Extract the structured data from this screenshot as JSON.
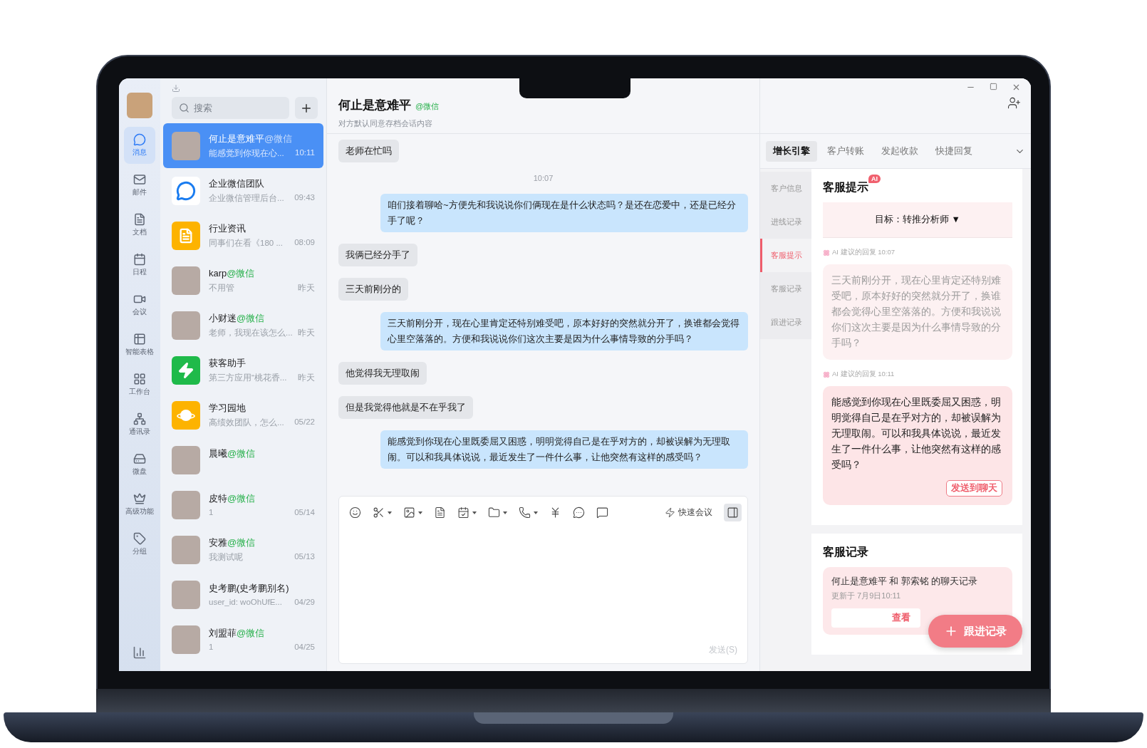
{
  "nav": {
    "items": [
      {
        "label": "消息",
        "selected": true
      },
      {
        "label": "邮件",
        "selected": false
      },
      {
        "label": "文档",
        "selected": false
      },
      {
        "label": "日程",
        "selected": false
      },
      {
        "label": "会议",
        "selected": false
      },
      {
        "label": "智能表格",
        "selected": false
      },
      {
        "label": "工作台",
        "selected": false
      },
      {
        "label": "通讯录",
        "selected": false
      },
      {
        "label": "微盘",
        "selected": false
      },
      {
        "label": "高级功能",
        "selected": false
      },
      {
        "label": "分组",
        "selected": false
      }
    ]
  },
  "chat_list": {
    "search": {
      "placeholder": "搜索"
    },
    "chats": [
      {
        "name": "何止是意难平",
        "tag": "@微信",
        "preview": "能感觉到你现在心...",
        "time": "10:11",
        "selected": true,
        "kind": "photo"
      },
      {
        "name": "企业微信团队",
        "preview": "企业微信管理后台...",
        "time": "09:43",
        "selected": false,
        "kind": "chat",
        "color": "#ffffff"
      },
      {
        "name": "行业资讯",
        "preview": "同事们在看《180 ...",
        "time": "08:09",
        "selected": false,
        "kind": "note",
        "color": "#fdb300"
      },
      {
        "name": "karp",
        "tag": "@微信",
        "preview": "不用管",
        "time": "昨天",
        "selected": false,
        "kind": "photo"
      },
      {
        "name": "小财迷",
        "tag": "@微信",
        "preview": "老师，我现在该怎么...",
        "time": "昨天",
        "selected": false,
        "kind": "photo"
      },
      {
        "name": "获客助手",
        "preview": "第三方应用“桃花香...",
        "time": "昨天",
        "selected": false,
        "kind": "bolt",
        "color": "#1fba4a"
      },
      {
        "name": "学习园地",
        "preview": "高绩效团队，怎么...",
        "time": "05/22",
        "selected": false,
        "kind": "planet",
        "color": "#fdb300"
      },
      {
        "name": "晨曦",
        "tag": "@微信",
        "selected": false,
        "kind": "photo"
      },
      {
        "name": "皮特",
        "tag": "@微信",
        "preview": "1",
        "time": "05/14",
        "selected": false,
        "kind": "photo"
      },
      {
        "name": "安雅",
        "tag": "@微信",
        "preview": "我测试呢",
        "time": "05/13",
        "selected": false,
        "kind": "photo"
      },
      {
        "name": "史考鹏(史考鹏别名)",
        "preview": "user_id: woOhUfE...",
        "time": "04/29",
        "selected": false,
        "kind": "photo"
      },
      {
        "name": "刘盟菲",
        "tag": "@微信",
        "preview": "1",
        "time": "04/25",
        "selected": false,
        "kind": "photo"
      }
    ]
  },
  "chat": {
    "title": "何止是意难平",
    "tag": "@微信",
    "subtitle": "对方默认同意存档会话内容",
    "messages": [
      {
        "kind": "received",
        "text": "老师在忙吗"
      },
      {
        "kind": "time",
        "text": "10:07"
      },
      {
        "kind": "sent",
        "text": "咱们接着聊哈~方便先和我说说你们俩现在是什么状态吗？是还在恋爱中，还是已经分手了呢？"
      },
      {
        "kind": "received",
        "text": "我俩已经分手了"
      },
      {
        "kind": "received",
        "text": "三天前刚分的"
      },
      {
        "kind": "sent",
        "text": "三天前刚分开，现在心里肯定还特别难受吧，原本好好的突然就分开了，换谁都会觉得心里空落落的。方便和我说说你们这次主要是因为什么事情导致的分手吗？"
      },
      {
        "kind": "received",
        "text": "他觉得我无理取闹"
      },
      {
        "kind": "received",
        "text": "但是我觉得他就是不在乎我了"
      },
      {
        "kind": "sent",
        "text": "能感觉到你现在心里既委屈又困惑，明明觉得自己是在乎对方的，却被误解为无理取闹。可以和我具体说说，最近发生了一件什么事，让他突然有这样的感受吗？"
      }
    ],
    "quick_meeting": "快速会议",
    "send": "发送(S)"
  },
  "assistant": {
    "tabs": [
      {
        "label": "增长引擎",
        "selected": true
      },
      {
        "label": "客户转账",
        "selected": false
      },
      {
        "label": "发起收款",
        "selected": false
      },
      {
        "label": "快捷回复",
        "selected": false
      }
    ],
    "sections": [
      {
        "label": "客户信息",
        "selected": false
      },
      {
        "label": "进线记录",
        "selected": false
      },
      {
        "label": "客服提示",
        "selected": true
      },
      {
        "label": "客服记录",
        "selected": false
      },
      {
        "label": "跟进记录",
        "selected": false
      }
    ],
    "hint": {
      "title": "客服提示",
      "badge": "AI",
      "goal": "目标：转推分析师 ▼",
      "suggestions": [
        {
          "meta": "AI 建议的回复 10:07",
          "text": "三天前刚分开，现在心里肯定还特别难受吧，原本好好的突然就分开了，换谁都会觉得心里空落落的。方便和我说说你们这次主要是因为什么事情导致的分手吗？",
          "highlighted": false
        },
        {
          "meta": "AI 建议的回复 10:11",
          "text": "能感觉到你现在心里既委屈又困惑，明明觉得自己是在乎对方的，却被误解为无理取闹。可以和我具体说说，最近发生了一件什么事，让他突然有这样的感受吗？",
          "highlighted": true,
          "action": "发送到聊天"
        }
      ]
    },
    "record": {
      "title": "客服记录",
      "card_title": "何止是意难平 和 郭索铭 的聊天记录",
      "updated": "更新于 7月9日10:11",
      "link": "查看"
    },
    "float_button": "跟进记录"
  }
}
